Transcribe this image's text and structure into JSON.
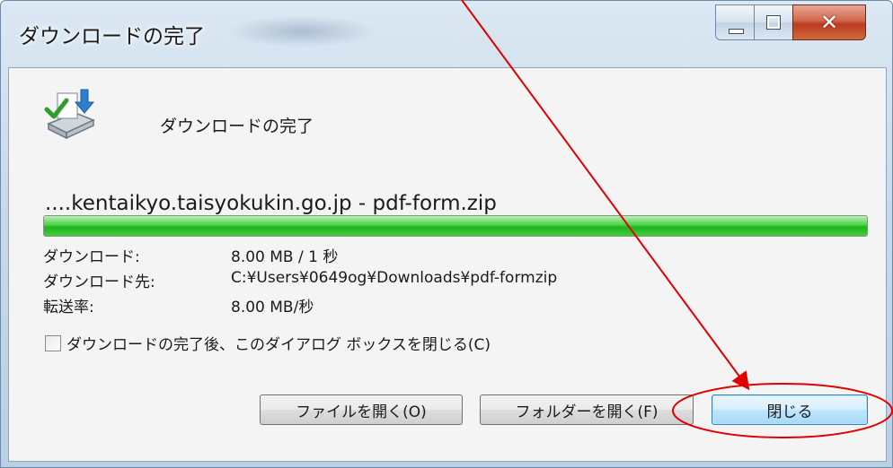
{
  "window": {
    "title": "ダウンロードの完了",
    "caption_buttons": {
      "minimize_icon": "minimize-icon",
      "maximize_icon": "maximize-icon",
      "close_icon": "close-icon"
    }
  },
  "dialog": {
    "icon": "download-complete-icon",
    "heading": "ダウンロードの完了",
    "filename": "....kentaikyo.taisyokukin.go.jp - pdf-form.zip",
    "progress": 1.0,
    "info": [
      {
        "label": "ダウンロード:",
        "value": "8.00 MB / 1 秒"
      },
      {
        "label": "ダウンロード先:",
        "value": "C:¥Users¥0649og¥Downloads¥pdf-formzip"
      },
      {
        "label": "転送率:",
        "value": "8.00 MB/秒"
      }
    ],
    "checkbox": {
      "label": "ダウンロードの完了後、このダイアログ ボックスを閉じる(C)",
      "checked": false
    },
    "buttons": {
      "open_file": "ファイルを開く(O)",
      "open_folder": "フォルダーを開く(F)",
      "close": "閉じる"
    }
  },
  "colors": {
    "accent_progress": "#22b520",
    "annotation": "#e00000",
    "default_button_border": "#3c7fb1"
  }
}
